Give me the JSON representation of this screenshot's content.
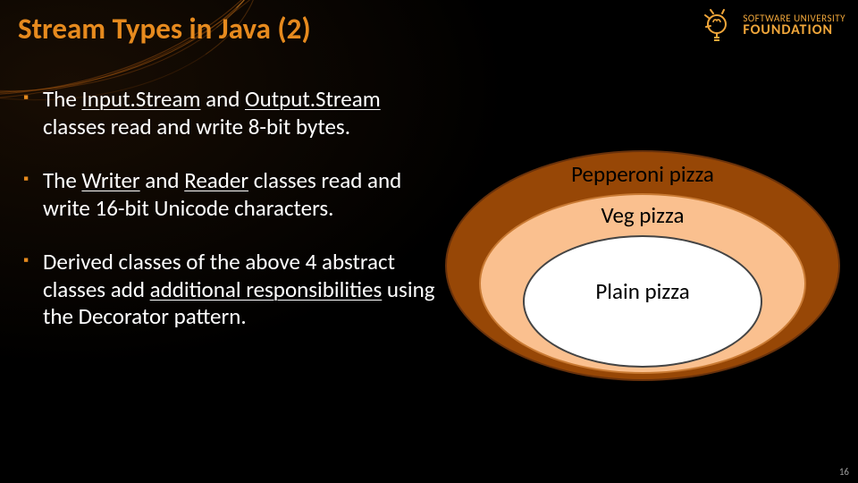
{
  "title": "Stream Types in Java (2)",
  "logo": {
    "line1": "SOFTWARE UNIVERSITY",
    "line2": "FOUNDATION"
  },
  "bullets": [
    {
      "pre": "The ",
      "u1": "Input.Stream",
      "mid": " and ",
      "u2": "Output.Stream",
      "post": " classes read and write 8-bit bytes."
    },
    {
      "pre": "The ",
      "u1": "Writer",
      "mid": " and ",
      "u2": "Reader",
      "post": " classes read and write 16-bit Unicode characters."
    },
    {
      "pre": "Derived classes of the above 4 abstract classes add ",
      "u1": "additional responsibilities",
      "mid": "",
      "u2": "",
      "post": " using the Decorator pattern."
    }
  ],
  "diagram": {
    "outer": "Pepperoni pizza",
    "mid": "Veg pizza",
    "inner": "Plain pizza"
  },
  "page": "16",
  "colors": {
    "accent": "#e68a1e",
    "outer_fill": "#974706",
    "mid_fill": "#fac08f",
    "inner_fill": "#ffffff"
  }
}
